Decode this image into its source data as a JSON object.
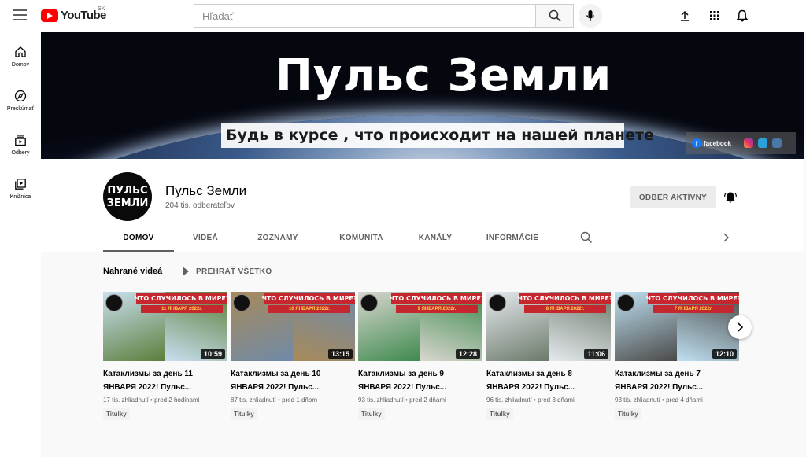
{
  "topbar": {
    "logo_text": "YouTube",
    "country_code": "SK",
    "search_placeholder": "Hľadať",
    "icons": [
      "menu-icon",
      "search-icon",
      "mic-icon",
      "upload-icon",
      "apps-icon",
      "notifications-icon"
    ]
  },
  "sidebar": {
    "items": [
      {
        "label": "Domov",
        "icon": "home-icon"
      },
      {
        "label": "Preskúmať",
        "icon": "explore-icon"
      },
      {
        "label": "Odbery",
        "icon": "subscriptions-icon"
      },
      {
        "label": "Knižnica",
        "icon": "library-icon"
      }
    ]
  },
  "banner": {
    "title": "Пульс Земли",
    "subtitle": "Будь в курсе , что происходит на нашей планете",
    "social": {
      "facebook_label": "facebook"
    }
  },
  "channel": {
    "avatar_line1": "ПУЛЬС",
    "avatar_line2": "ЗЕМЛИ",
    "name": "Пульс Земли",
    "subscribers": "204 tis. odberateľov",
    "subscribe_button": "ODBER AKTÍVNY",
    "tabs": [
      "DOMOV",
      "VIDEÁ",
      "ZOZNAMY",
      "KOMUNITA",
      "KANÁLY",
      "INFORMÁCIE"
    ]
  },
  "section": {
    "title": "Nahrané videá",
    "play_all": "PREHRAŤ VŠETKO"
  },
  "videos": [
    {
      "thumb_heading": "ЧТО СЛУЧИЛОСЬ В МИРЕ?",
      "thumb_date": "11 ЯНВАРЯ 2022г.",
      "duration": "10:59",
      "title": "Катаклизмы за день 11 ЯНВАРЯ 2022! Пульс...",
      "views": "17 tis. zhliadnutí",
      "age": "pred 2 hodinami",
      "badge": "Titulky",
      "colors": [
        "#c9dff0",
        "#5b7f3a"
      ]
    },
    {
      "thumb_heading": "ЧТО СЛУЧИЛОСЬ В МИРЕ?",
      "thumb_date": "10 ЯНВАРЯ 2022г.",
      "duration": "13:15",
      "title": "Катаклизмы за день 10 ЯНВАРЯ 2022! Пульс...",
      "views": "87 tis. zhliadnutí",
      "age": "pred 1 dňom",
      "badge": "Titulky",
      "colors": [
        "#a88a5a",
        "#6f8aa8"
      ]
    },
    {
      "thumb_heading": "ЧТО СЛУЧИЛОСЬ В МИРЕ?",
      "thumb_date": "9 ЯНВАРЯ 2022г.",
      "duration": "12:28",
      "title": "Катаклизмы за день 9 ЯНВАРЯ 2022! Пульс...",
      "views": "93 tis. zhliadnutí",
      "age": "pred 2 dňami",
      "badge": "Titulky",
      "colors": [
        "#d8d6cf",
        "#3e8a4e"
      ]
    },
    {
      "thumb_heading": "ЧТО СЛУЧИЛОСЬ В МИРЕ?",
      "thumb_date": "8 ЯНВАРЯ 2022г.",
      "duration": "11:06",
      "title": "Катаклизмы за день 8 ЯНВАРЯ 2022! Пульс...",
      "views": "96 tis. zhliadnutí",
      "age": "pred 3 dňami",
      "badge": "Titulky",
      "colors": [
        "#e6e9ee",
        "#6b7a6a"
      ]
    },
    {
      "thumb_heading": "ЧТО СЛУЧИЛОСЬ В МИРЕ?",
      "thumb_date": "7 ЯНВАРЯ 2022г.",
      "duration": "12:10",
      "title": "Катаклизмы за день 7 ЯНВАРЯ 2022! Пульс...",
      "views": "93 tis. zhliadnutí",
      "age": "pred 4 dňami",
      "badge": "Titulky",
      "colors": [
        "#bfe0f2",
        "#4a4a48"
      ]
    }
  ],
  "colors": {
    "brand_red": "#ff0000",
    "thumb_red": "#c6262e",
    "text_secondary": "#606060"
  }
}
